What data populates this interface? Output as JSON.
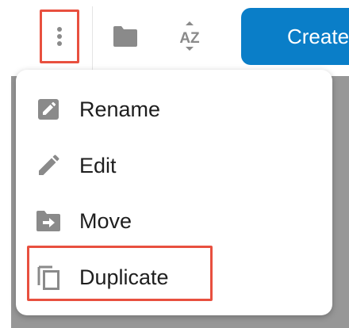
{
  "toolbar": {
    "more_icon": "vertical-ellipsis-icon",
    "folder_icon": "folder-icon",
    "sort_icon": "sort-az-icon",
    "sort_label": "AZ",
    "create_label": "Create"
  },
  "menu": {
    "items": [
      {
        "label": "Rename",
        "icon": "rename-icon"
      },
      {
        "label": "Edit",
        "icon": "pencil-icon"
      },
      {
        "label": "Move",
        "icon": "move-folder-icon"
      },
      {
        "label": "Duplicate",
        "icon": "duplicate-icon"
      }
    ]
  },
  "colors": {
    "accent_blue": "#0a7ec8",
    "highlight_red": "#e8503f",
    "backdrop_gray": "#979797",
    "icon_gray": "#8a8a8a",
    "text": "#1e1e1e"
  }
}
